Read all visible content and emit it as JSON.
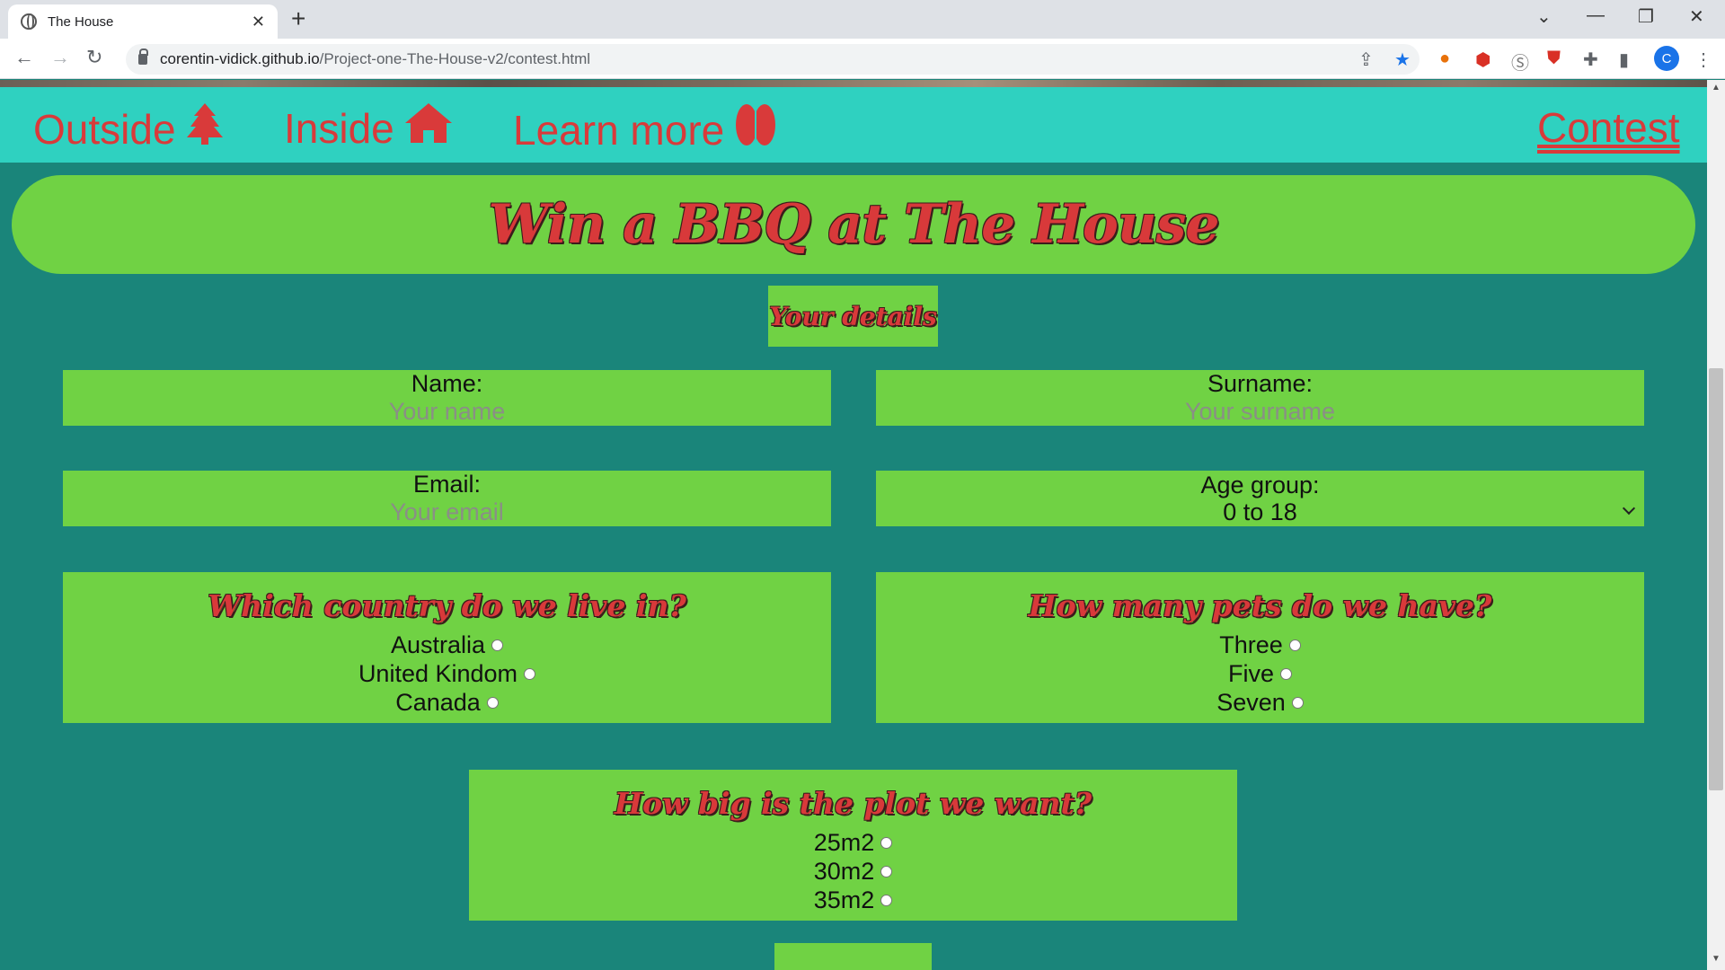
{
  "browser": {
    "tab_title": "The House",
    "url_domain": "corentin-vidick.github.io",
    "url_path": "/Project-one-The-House-v2/contest.html",
    "profile_initial": "C"
  },
  "nav": {
    "outside": "Outside",
    "inside": "Inside",
    "learn_more": "Learn more",
    "contest": "Contest"
  },
  "hero": {
    "title": "Win a BBQ at The House"
  },
  "details": {
    "title": "Your details",
    "name_label": "Name:",
    "name_placeholder": "Your name",
    "surname_label": "Surname:",
    "surname_placeholder": "Your surname",
    "email_label": "Email:",
    "email_placeholder": "Your email",
    "age_label": "Age group:",
    "age_selected": "0 to 18"
  },
  "quiz": {
    "country": {
      "question": "Which country do we live in?",
      "options": [
        "Australia",
        "United Kindom",
        "Canada"
      ]
    },
    "pets": {
      "question": "How many pets do we have?",
      "options": [
        "Three",
        "Five",
        "Seven"
      ]
    },
    "plot": {
      "question": "How big is the plot we want?",
      "options": [
        "25m2",
        "30m2",
        "35m2"
      ]
    }
  },
  "colors": {
    "teal": "#1a857a",
    "nav_bg": "#2fd1c0",
    "green": "#70d244",
    "red": "#d93a3a"
  }
}
